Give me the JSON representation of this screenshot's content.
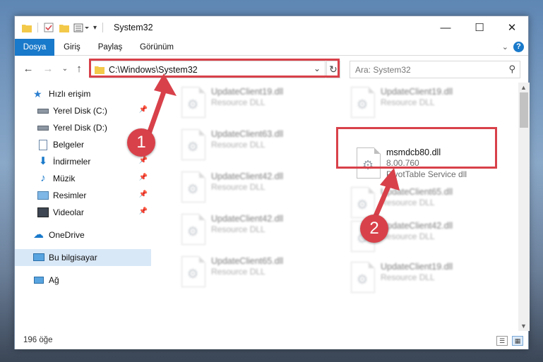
{
  "window": {
    "title": "System32",
    "controls": {
      "minimize": "—",
      "maximize": "☐",
      "close": "✕"
    }
  },
  "ribbon": {
    "tabs": [
      "Dosya",
      "Giriş",
      "Paylaş",
      "Görünüm"
    ],
    "active_tab": "Dosya"
  },
  "nav": {
    "address": "C:\\Windows\\System32",
    "search_placeholder": "Ara: System32"
  },
  "sidebar": {
    "items": [
      {
        "label": "Hızlı erişim",
        "icon": "star-icon"
      },
      {
        "label": "Yerel Disk (C:)",
        "icon": "drive-icon",
        "pinned": true
      },
      {
        "label": "Yerel Disk (D:)",
        "icon": "drive-icon"
      },
      {
        "label": "Belgeler",
        "icon": "documents-icon"
      },
      {
        "label": "İndirmeler",
        "icon": "download-icon",
        "pinned": true
      },
      {
        "label": "Müzik",
        "icon": "music-icon",
        "pinned": true
      },
      {
        "label": "Resimler",
        "icon": "pictures-icon",
        "pinned": true
      },
      {
        "label": "Videolar",
        "icon": "videos-icon",
        "pinned": true
      },
      {
        "label": "OneDrive",
        "icon": "cloud-icon"
      },
      {
        "label": "Bu bilgisayar",
        "icon": "computer-icon",
        "selected": true
      },
      {
        "label": "Ağ",
        "icon": "network-icon"
      }
    ]
  },
  "files": {
    "left": [
      {
        "name": "UpdateClient19.dll",
        "desc": "Resource DLL"
      },
      {
        "name": "UpdateClient63.dll",
        "desc": "Resource DLL"
      },
      {
        "name": "UpdateClient42.dll",
        "desc": "Resource DLL"
      },
      {
        "name": "UpdateClient42.dll",
        "desc": "Resource DLL"
      },
      {
        "name": "UpdateClient65.dll",
        "desc": "Resource DLL"
      }
    ],
    "right": [
      {
        "name": "UpdateClient19.dll",
        "desc": "Resource DLL"
      },
      {
        "name": "UpdateClient65.dll",
        "desc": "Resource DLL"
      },
      {
        "name": "UpdateClient42.dll",
        "desc": "Resource DLL"
      },
      {
        "name": "UpdateClient19.dll",
        "desc": "Resource DLL"
      }
    ],
    "selected": {
      "name": "msmdcb80.dll",
      "version": "8.00.760",
      "desc": "PivotTable Service dll"
    }
  },
  "status": {
    "item_count": "196 öğe"
  },
  "callouts": {
    "one": "1",
    "two": "2"
  },
  "colors": {
    "accent": "#1979ca",
    "highlight": "#d8414a"
  }
}
